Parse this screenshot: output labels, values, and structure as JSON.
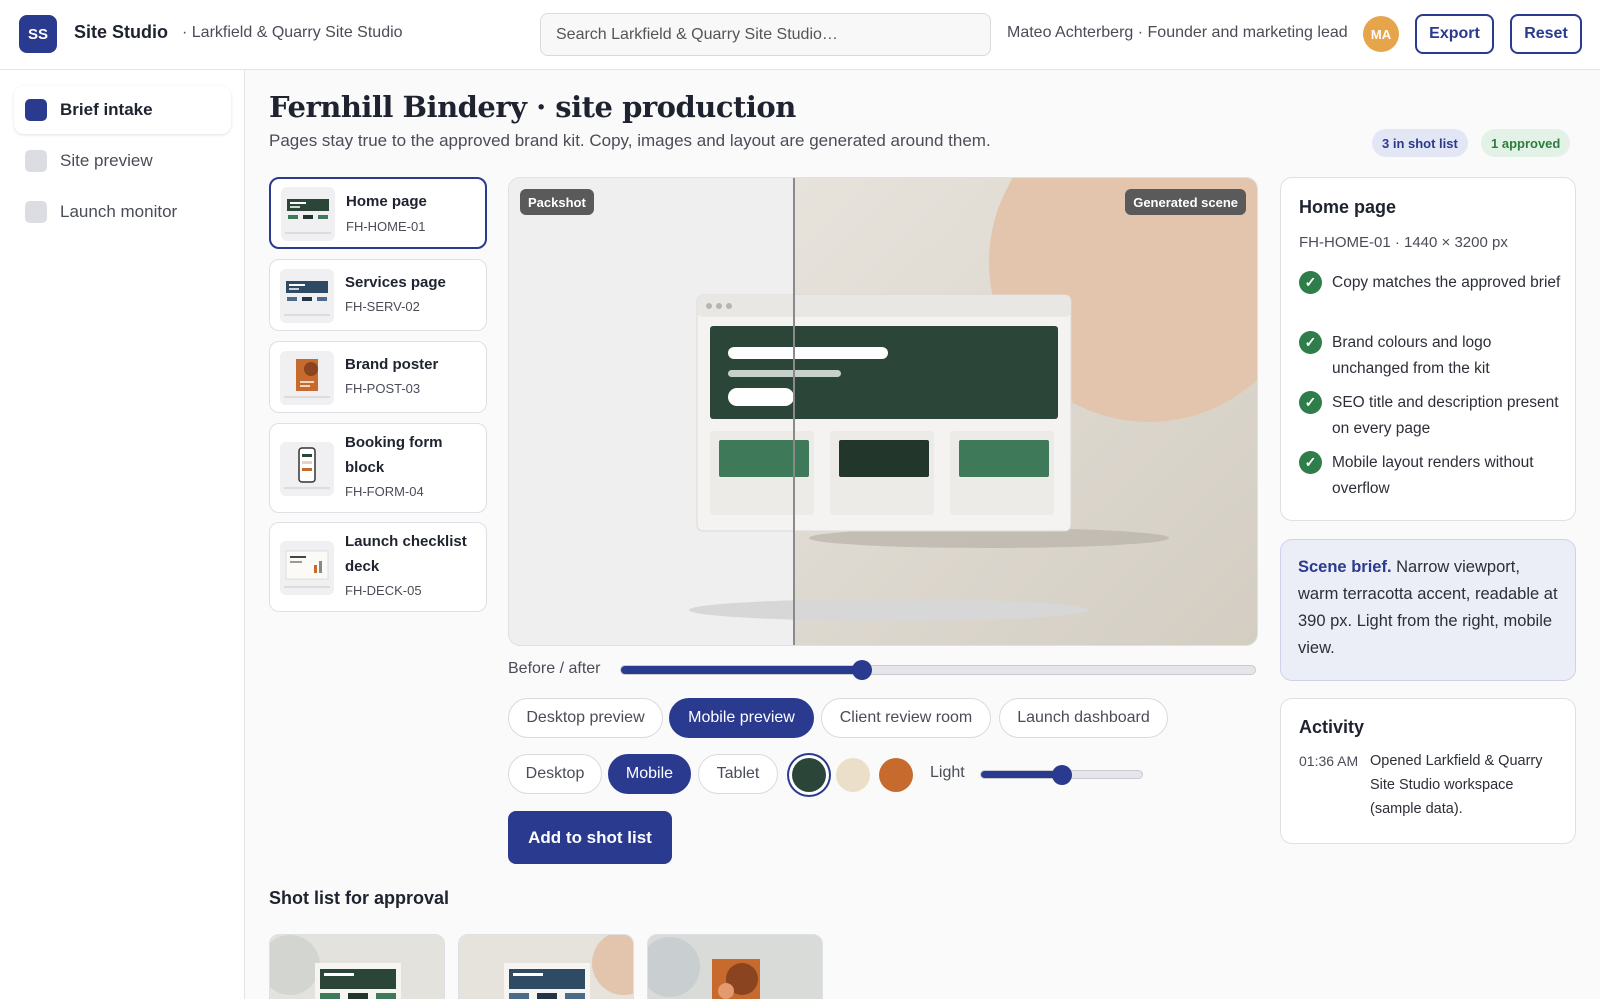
{
  "app": {
    "logo_initials": "SS",
    "name": "Site Studio",
    "workspace": "· Larkfield & Quarry Site Studio"
  },
  "search": {
    "placeholder": "Search Larkfield & Quarry Site Studio…"
  },
  "user": {
    "label": "Mateo Achterberg · Founder and marketing lead",
    "initials": "MA"
  },
  "header_buttons": {
    "export": "Export",
    "reset": "Reset"
  },
  "sidebar": {
    "items": [
      {
        "label": "Brief intake",
        "active": true
      },
      {
        "label": "Site preview",
        "active": false
      },
      {
        "label": "Launch monitor",
        "active": false
      }
    ]
  },
  "page": {
    "title": "Fernhill Bindery · site production",
    "subtitle": "Pages stay true to the approved brand kit. Copy, images and layout are generated around them.",
    "badges": {
      "shot_list": "3 in shot list",
      "approved": "1 approved"
    }
  },
  "assets": [
    {
      "name": "Home page",
      "code": "FH-HOME-01",
      "selected": true
    },
    {
      "name": "Services page",
      "code": "FH-SERV-02",
      "selected": false
    },
    {
      "name": "Brand poster",
      "code": "FH-POST-03",
      "selected": false
    },
    {
      "name": "Booking form block",
      "code": "FH-FORM-04",
      "selected": false
    },
    {
      "name": "Launch checklist deck",
      "code": "FH-DECK-05",
      "selected": false
    }
  ],
  "preview": {
    "before_tag": "Packshot",
    "after_tag": "Generated scene",
    "slider_label": "Before / after",
    "slider_value": 0.38
  },
  "view_modes": [
    {
      "label": "Desktop preview",
      "active": false
    },
    {
      "label": "Mobile preview",
      "active": true
    },
    {
      "label": "Client review room",
      "active": false
    },
    {
      "label": "Launch dashboard",
      "active": false
    }
  ],
  "devices": [
    {
      "label": "Desktop",
      "active": false
    },
    {
      "label": "Mobile",
      "active": true
    },
    {
      "label": "Tablet",
      "active": false
    }
  ],
  "swatches": [
    {
      "color": "#2b4638",
      "selected": true
    },
    {
      "color": "#ecdfca",
      "selected": false
    },
    {
      "color": "#c66a2e",
      "selected": false
    }
  ],
  "light": {
    "label": "Light",
    "value": 0.5
  },
  "primary_action": "Add to shot list",
  "details": {
    "title": "Home page",
    "meta": "FH-HOME-01 · 1440 × 3200 px",
    "checks": [
      "Copy matches the approved brief",
      "Brand colours and logo unchanged from the kit",
      "SEO title and description present on every page",
      "Mobile layout renders without overflow"
    ],
    "check_icon": "checkmark-icon"
  },
  "scene_brief": {
    "heading": "Scene brief.",
    "text": " Narrow viewport, warm terracotta accent, readable at 390 px. Light from the right, mobile view."
  },
  "activity": {
    "title": "Activity",
    "entries": [
      {
        "time": "01:36 AM",
        "text": "Opened Larkfield & Quarry Site Studio workspace (sample data)."
      }
    ]
  },
  "shot_list": {
    "title": "Shot list for approval"
  },
  "colors": {
    "accent": "#2a3a8f",
    "success": "#2e7d4a",
    "brand_green": "#2b4638",
    "terracotta": "#c66a2e"
  }
}
